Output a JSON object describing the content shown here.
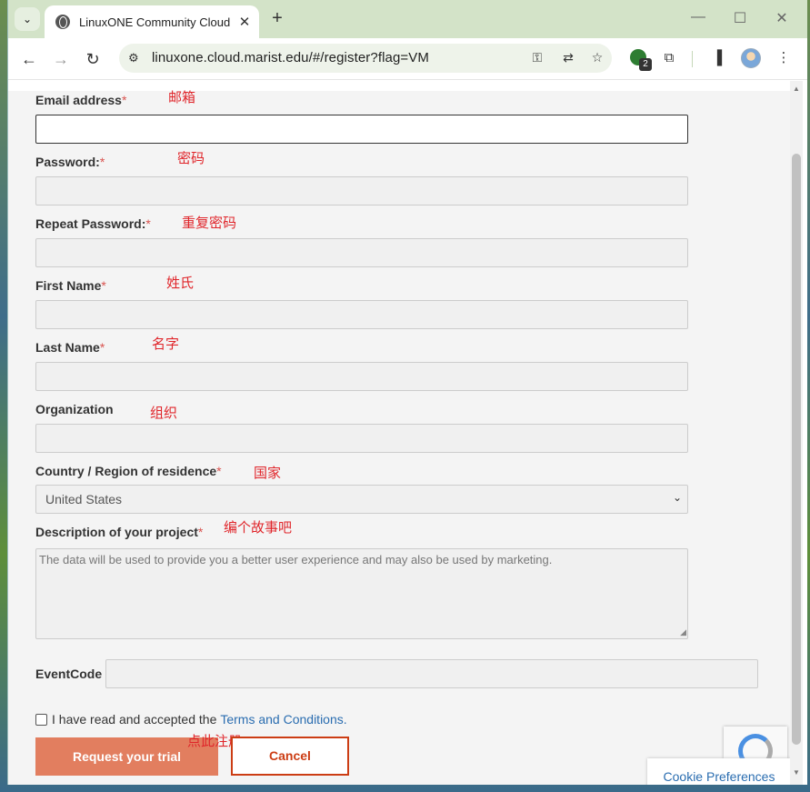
{
  "browser": {
    "tab_title": "LinuxONE Community Cloud",
    "url": "linuxone.cloud.marist.edu/#/register?flag=VM",
    "ext_badge_count": "2"
  },
  "form": {
    "email": {
      "label": "Email address",
      "required": "*",
      "note": "邮箱"
    },
    "password": {
      "label": "Password:",
      "required": "*",
      "note": "密码"
    },
    "repeat_password": {
      "label": "Repeat Password:",
      "required": "*",
      "note": "重复密码"
    },
    "first_name": {
      "label": "First Name",
      "required": "*",
      "note": "姓氏"
    },
    "last_name": {
      "label": "Last Name",
      "required": "*",
      "note": "名字"
    },
    "organization": {
      "label": "Organization",
      "note": "组织"
    },
    "country": {
      "label": "Country / Region of residence",
      "required": "*",
      "note": "国家",
      "value": "United States"
    },
    "description": {
      "label": "Description of your project",
      "required": "*",
      "note": "编个故事吧",
      "placeholder": "The data will be used to provide you a better user experience and may also be used by marketing."
    },
    "event_code": {
      "label": "EventCode"
    },
    "terms": {
      "text": "I have read and accepted the",
      "link": "Terms and Conditions."
    },
    "submit_label": "Request your trial",
    "submit_note": "点此注册",
    "cancel_label": "Cancel"
  },
  "cookie_label": "Cookie Preferences",
  "colors": {
    "required": "#d9534f",
    "note": "#e0262b",
    "primary": "#e27e5f",
    "cancel": "#cc3d14",
    "link": "#2a6db0"
  }
}
